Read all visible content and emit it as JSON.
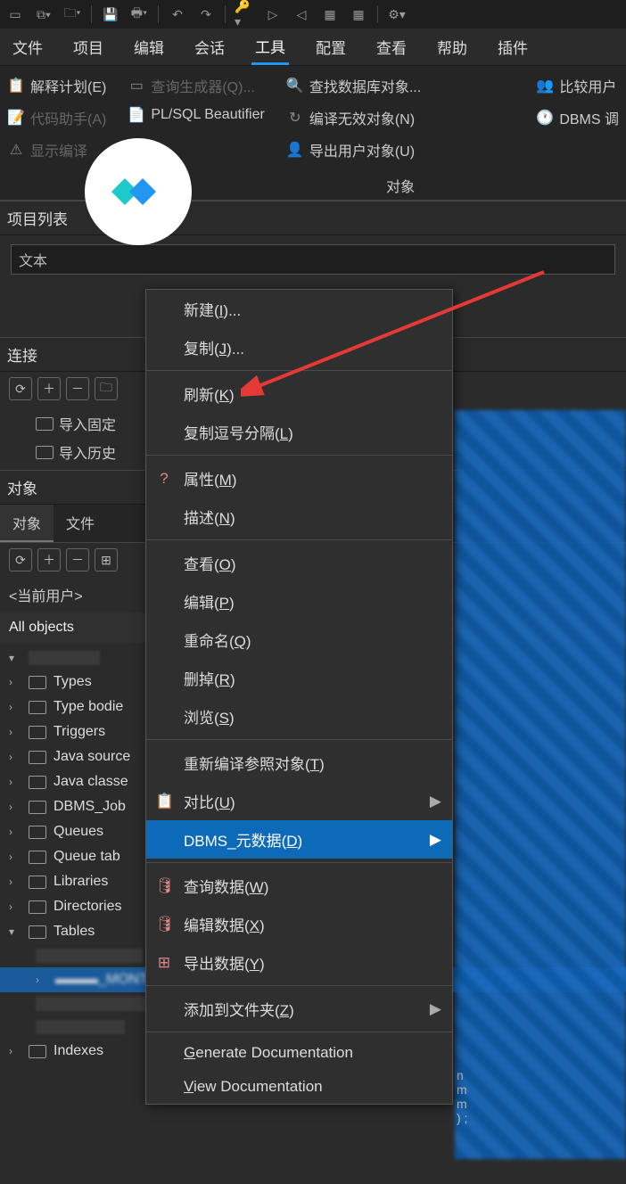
{
  "toolbar": {
    "icons": [
      "new",
      "window",
      "open",
      "save",
      "print",
      "undo",
      "redo",
      "key",
      "run",
      "stop",
      "grid",
      "settings"
    ]
  },
  "menubar": {
    "items": [
      "文件",
      "项目",
      "编辑",
      "会话",
      "工具",
      "配置",
      "查看",
      "帮助",
      "插件"
    ],
    "active": 4
  },
  "ribbon": {
    "left": [
      {
        "label": "解释计划(E)",
        "dim": false
      },
      {
        "label": "代码助手(A)",
        "dim": true
      },
      {
        "label": "显示编译",
        "dim": true
      }
    ],
    "mid": [
      {
        "label": "查询生成器(Q)...",
        "dim": true
      },
      {
        "label": "PL/SQL Beautifier",
        "dim": false
      }
    ],
    "obj": [
      {
        "label": "查找数据库对象..."
      },
      {
        "label": "编译无效对象(N)"
      },
      {
        "label": "导出用户对象(U)"
      }
    ],
    "right": [
      {
        "label": "比较用户"
      },
      {
        "label": "DBMS 调"
      }
    ],
    "group_label": "对象"
  },
  "panels": {
    "project": "项目列表",
    "project_input": "文本",
    "connection": "连接",
    "conn_items": [
      "导入固定",
      "导入历史"
    ],
    "objects": "对象",
    "tabs": [
      "对象",
      "文件"
    ],
    "current_user": "<当前用户>",
    "all_objects": "All objects"
  },
  "tree": [
    {
      "label": "Types",
      "exp": ">"
    },
    {
      "label": "Type bodie",
      "exp": ">"
    },
    {
      "label": "Triggers",
      "exp": ">"
    },
    {
      "label": "Java source",
      "exp": ">"
    },
    {
      "label": "Java classe",
      "exp": ">"
    },
    {
      "label": "DBMS_Job",
      "exp": ">"
    },
    {
      "label": "Queues",
      "exp": ">"
    },
    {
      "label": "Queue tab",
      "exp": ">"
    },
    {
      "label": "Libraries",
      "exp": ">"
    },
    {
      "label": "Directories",
      "exp": ">"
    },
    {
      "label": "Tables",
      "exp": "v"
    },
    {
      "label": "Indexes",
      "exp": ">"
    }
  ],
  "context_menu": [
    {
      "label": "新建(I)...",
      "type": "item"
    },
    {
      "label": "复制(J)...",
      "type": "item"
    },
    {
      "type": "sep"
    },
    {
      "label": "刷新(K)",
      "type": "item"
    },
    {
      "label": "复制逗号分隔(L)",
      "type": "item"
    },
    {
      "type": "sep"
    },
    {
      "label": "属性(M)",
      "type": "item",
      "icon": "?"
    },
    {
      "label": "描述(N)",
      "type": "item"
    },
    {
      "type": "sep"
    },
    {
      "label": "查看(O)",
      "type": "item"
    },
    {
      "label": "编辑(P)",
      "type": "item"
    },
    {
      "label": "重命名(Q)",
      "type": "item"
    },
    {
      "label": "删掉(R)",
      "type": "item"
    },
    {
      "label": "浏览(S)",
      "type": "item"
    },
    {
      "type": "sep"
    },
    {
      "label": "重新编译参照对象(T)",
      "type": "item"
    },
    {
      "label": "对比(U)",
      "type": "item",
      "icon": "📋",
      "sub": true
    },
    {
      "label": "DBMS_元数据(D)",
      "type": "item",
      "sub": true,
      "hilite": true
    },
    {
      "type": "sep"
    },
    {
      "label": "查询数据(W)",
      "type": "item",
      "icon": "🛢"
    },
    {
      "label": "编辑数据(X)",
      "type": "item",
      "icon": "🛢"
    },
    {
      "label": "导出数据(Y)",
      "type": "item",
      "icon": "⊞"
    },
    {
      "type": "sep"
    },
    {
      "label": "添加到文件夹(Z)",
      "type": "item",
      "sub": true
    },
    {
      "type": "sep"
    },
    {
      "label": "Generate Documentation",
      "type": "item",
      "u": "G"
    },
    {
      "label": "View Documentation",
      "type": "item",
      "u": "V"
    }
  ],
  "code_snippet": [
    "n",
    "m",
    "m",
    ") ;"
  ]
}
